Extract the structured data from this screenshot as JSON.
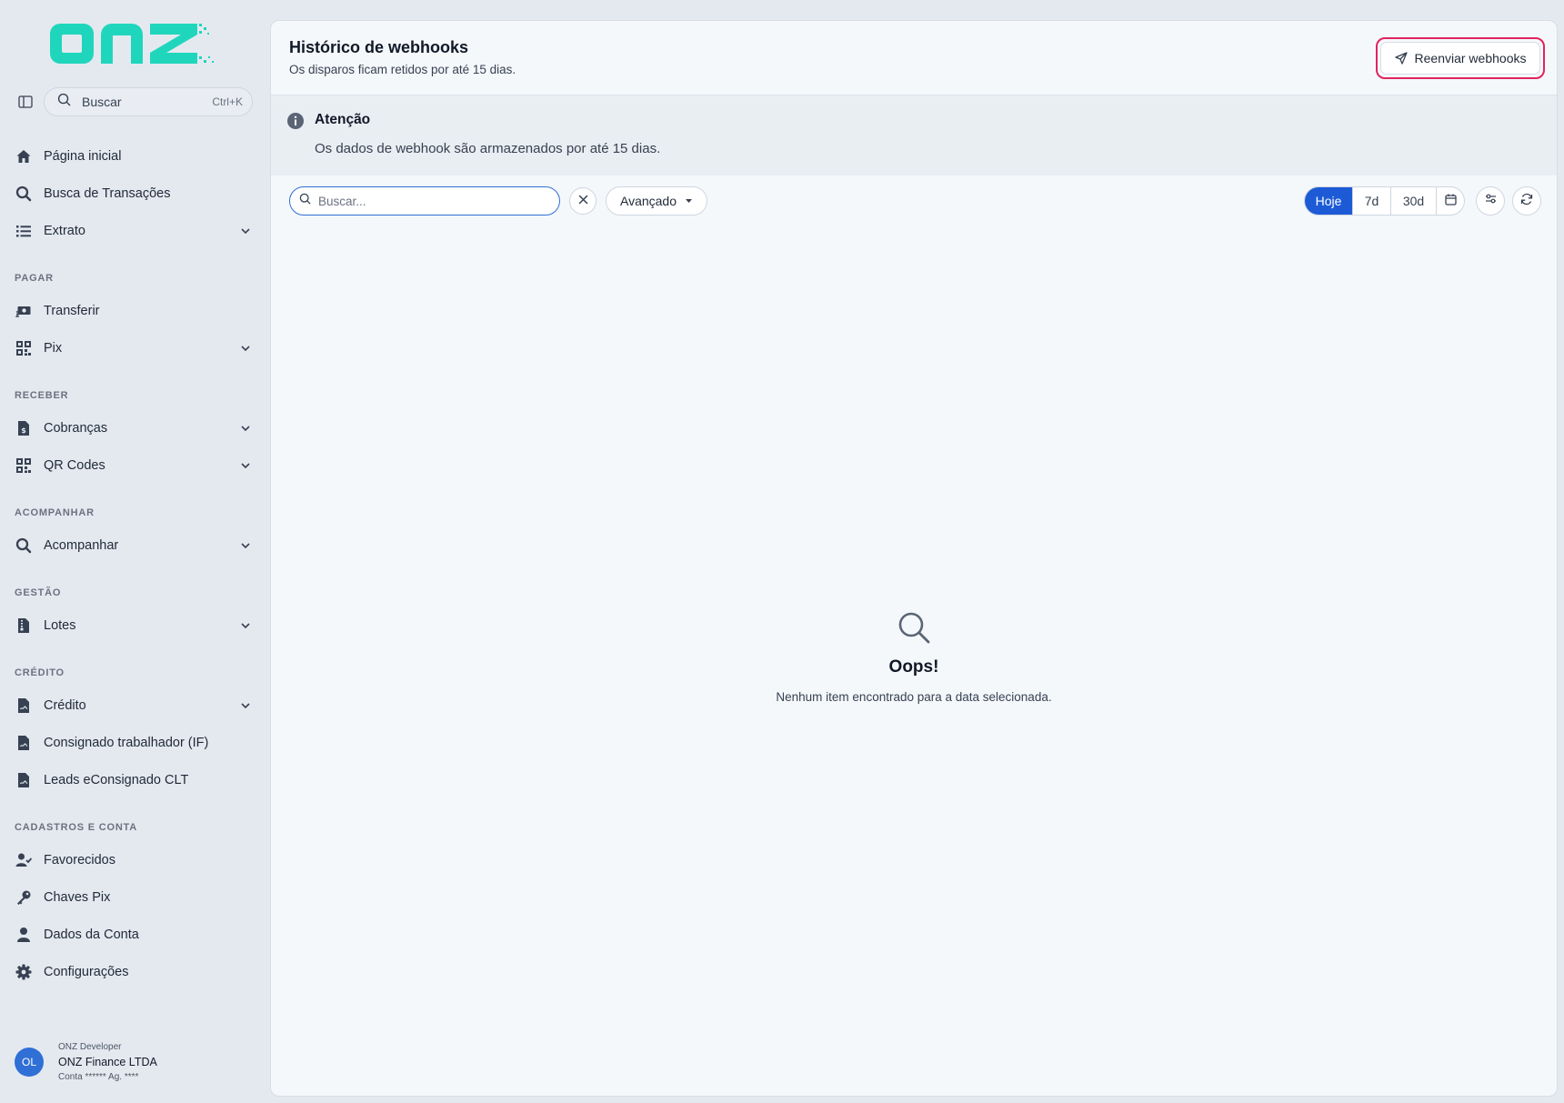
{
  "sidebar": {
    "logo_text": "onz",
    "search": {
      "label": "Buscar",
      "shortcut": "Ctrl+K"
    },
    "items": [
      {
        "label": "Página inicial",
        "icon": "home-icon"
      },
      {
        "label": "Busca de Transações",
        "icon": "search-icon"
      },
      {
        "label": "Extrato",
        "icon": "list-icon",
        "expandable": true
      }
    ],
    "sections": [
      {
        "title": "PAGAR",
        "items": [
          {
            "label": "Transferir",
            "icon": "money-transfer-icon"
          },
          {
            "label": "Pix",
            "icon": "qr-grid-icon",
            "expandable": true
          }
        ]
      },
      {
        "title": "RECEBER",
        "items": [
          {
            "label": "Cobranças",
            "icon": "invoice-icon",
            "expandable": true
          },
          {
            "label": "QR Codes",
            "icon": "qr-grid-icon",
            "expandable": true
          }
        ]
      },
      {
        "title": "ACOMPANHAR",
        "items": [
          {
            "label": "Acompanhar",
            "icon": "search-icon",
            "expandable": true
          }
        ]
      },
      {
        "title": "GESTÃO",
        "items": [
          {
            "label": "Lotes",
            "icon": "file-zip-icon",
            "expandable": true
          }
        ]
      },
      {
        "title": "CRÉDITO",
        "items": [
          {
            "label": "Crédito",
            "icon": "file-signature-icon",
            "expandable": true
          },
          {
            "label": "Consignado trabalhador (IF)",
            "icon": "file-signature-icon"
          },
          {
            "label": "Leads eConsignado CLT",
            "icon": "file-signature-icon"
          }
        ]
      },
      {
        "title": "CADASTROS E CONTA",
        "items": [
          {
            "label": "Favorecidos",
            "icon": "user-check-icon"
          },
          {
            "label": "Chaves Pix",
            "icon": "key-icon"
          },
          {
            "label": "Dados da Conta",
            "icon": "user-icon"
          },
          {
            "label": "Configurações",
            "icon": "gear-icon"
          }
        ]
      }
    ],
    "user": {
      "initials": "OL",
      "role": "ONZ Developer",
      "company": "ONZ Finance LTDA",
      "account": "Conta ****** Ag. ****"
    }
  },
  "header": {
    "title": "Histórico de webhooks",
    "subtitle": "Os disparos ficam retidos por até 15 dias.",
    "resend_label": "Reenviar webhooks"
  },
  "alert": {
    "title": "Atenção",
    "text": "Os dados de webhook são armazenados por até 15 dias."
  },
  "toolbar": {
    "search_placeholder": "Buscar...",
    "advanced_label": "Avançado",
    "ranges": [
      "Hoje",
      "7d",
      "30d"
    ],
    "active_range": "Hoje"
  },
  "empty_state": {
    "title": "Oops!",
    "text": "Nenhum item encontrado para a data selecionada."
  },
  "colors": {
    "brand": "#1fd6bd",
    "primary": "#1d5bd6",
    "highlight": "#e0245e"
  }
}
